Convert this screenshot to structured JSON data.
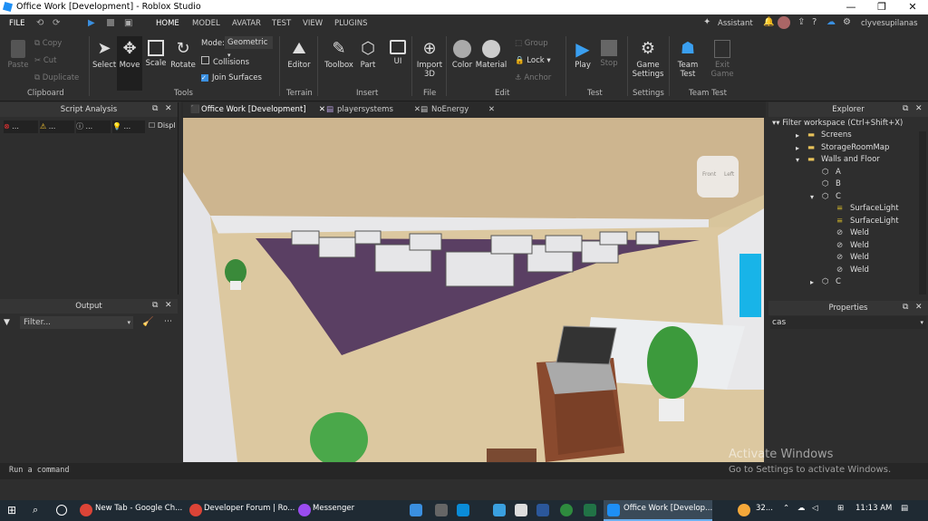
{
  "window": {
    "title": "Office Work [Development] - Roblox Studio",
    "minimize": "—",
    "maximize": "❐",
    "close": "✕"
  },
  "menu": {
    "file": "FILE",
    "tabs": [
      "HOME",
      "MODEL",
      "AVATAR",
      "TEST",
      "VIEW",
      "PLUGINS"
    ],
    "assistant": "Assistant",
    "user": "clyvesupilanas"
  },
  "ribbon": {
    "clipboard": {
      "paste": "Paste",
      "copy": "Copy",
      "cut": "Cut",
      "duplicate": "Duplicate",
      "label": "Clipboard"
    },
    "tools": {
      "select": "Select",
      "move": "Move",
      "scale": "Scale",
      "rotate": "Rotate",
      "mode_label": "Mode:",
      "mode_value": "Geometric",
      "collisions": "Collisions",
      "join": "Join Surfaces",
      "label": "Tools"
    },
    "terrain": {
      "editor": "Editor",
      "label": "Terrain"
    },
    "insert": {
      "toolbox": "Toolbox",
      "part": "Part",
      "ui": "UI",
      "label": "Insert"
    },
    "file": {
      "import": "Import",
      "import2": "3D",
      "label": "File"
    },
    "edit": {
      "color": "Color",
      "material": "Material",
      "group": "Group",
      "lock": "Lock",
      "anchor": "Anchor",
      "label": "Edit"
    },
    "test": {
      "play": "Play",
      "stop": "Stop",
      "label": "Test"
    },
    "settings": {
      "game": "Game",
      "game2": "Settings",
      "label": "Settings"
    },
    "teamtest": {
      "team": "Team",
      "team2": "Test",
      "exit": "Exit",
      "exit2": "Game",
      "label": "Team Test"
    }
  },
  "script_analysis": {
    "title": "Script Analysis",
    "filters": [
      "...",
      "...",
      "...",
      "..."
    ],
    "disp": "Displ"
  },
  "output": {
    "title": "Output",
    "filter_placeholder": "Filter..."
  },
  "doc_tabs": [
    "Office Work [Development]",
    "playersystems",
    "NoEnergy"
  ],
  "explorer": {
    "title": "Explorer",
    "filter": "Filter workspace (Ctrl+Shift+X)",
    "items": [
      {
        "label": "Screens",
        "indent": 1,
        "icon": "folder-icon",
        "arrow": "▸"
      },
      {
        "label": "StorageRoomMap",
        "indent": 1,
        "icon": "folder-icon",
        "arrow": "▸"
      },
      {
        "label": "Walls and Floor",
        "indent": 1,
        "icon": "folder-icon",
        "arrow": "▾"
      },
      {
        "label": "A",
        "indent": 2,
        "icon": "part-icon",
        "arrow": ""
      },
      {
        "label": "B",
        "indent": 2,
        "icon": "part-icon",
        "arrow": ""
      },
      {
        "label": "C",
        "indent": 2,
        "icon": "part-icon",
        "arrow": "▾"
      },
      {
        "label": "SurfaceLight",
        "indent": 3,
        "icon": "light-icon",
        "arrow": ""
      },
      {
        "label": "SurfaceLight",
        "indent": 3,
        "icon": "light-icon",
        "arrow": ""
      },
      {
        "label": "Weld",
        "indent": 3,
        "icon": "weld-icon",
        "arrow": ""
      },
      {
        "label": "Weld",
        "indent": 3,
        "icon": "weld-icon",
        "arrow": ""
      },
      {
        "label": "Weld",
        "indent": 3,
        "icon": "weld-icon",
        "arrow": ""
      },
      {
        "label": "Weld",
        "indent": 3,
        "icon": "weld-icon",
        "arrow": ""
      },
      {
        "label": "C",
        "indent": 2,
        "icon": "part-icon",
        "arrow": "▸"
      }
    ]
  },
  "properties": {
    "title": "Properties",
    "search_value": "cas"
  },
  "command": {
    "placeholder": "Run a command"
  },
  "activate": {
    "line1": "Activate Windows",
    "line2": "Go to Settings to activate Windows."
  },
  "viewcube": {
    "front": "Front",
    "left": "Left"
  },
  "taskbar": {
    "items": [
      "New Tab - Google Ch...",
      "Developer Forum | Ro...",
      "Messenger",
      "Office Work [Develop..."
    ],
    "weather": "32...",
    "time": "11:13 AM"
  }
}
